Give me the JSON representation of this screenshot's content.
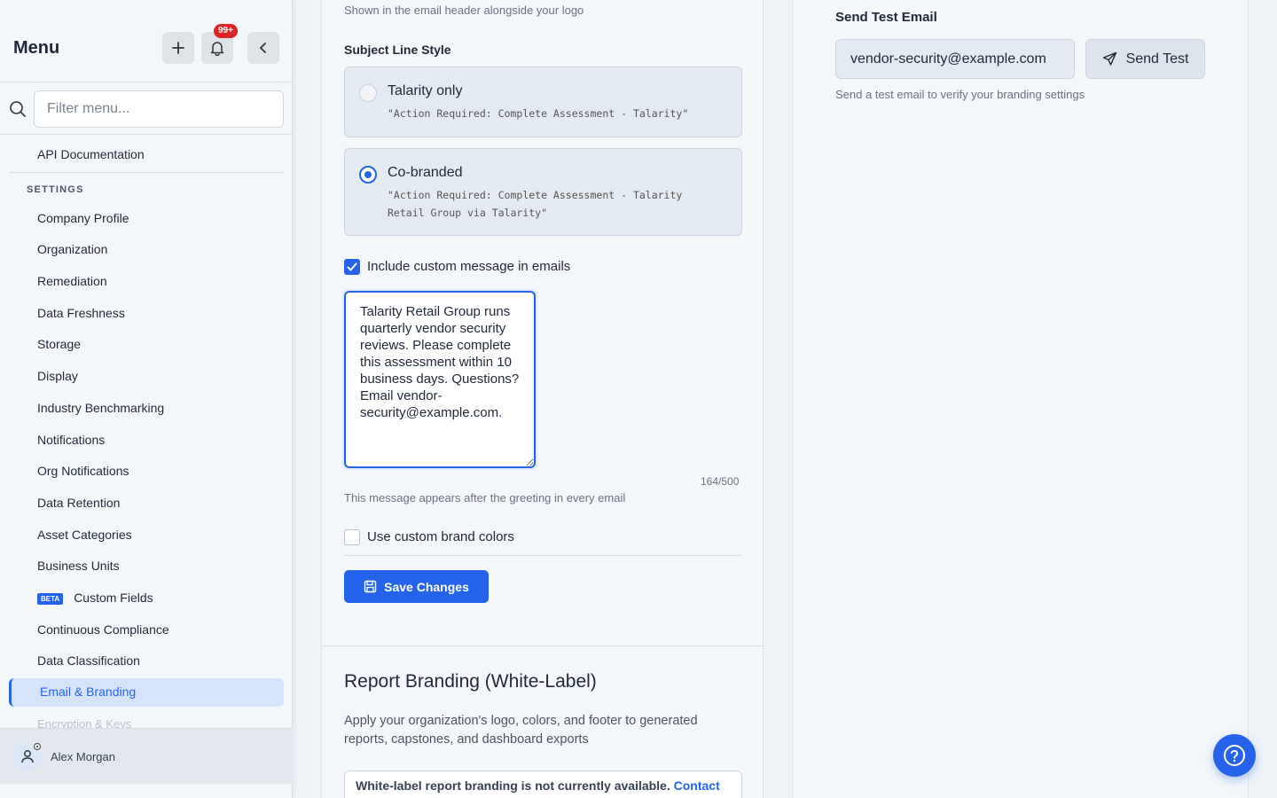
{
  "sidebar": {
    "title": "Menu",
    "notifications_badge": "99+",
    "search_placeholder": "Filter menu...",
    "top_item": "API Documentation",
    "section_label": "SETTINGS",
    "items": [
      "Company Profile",
      "Organization",
      "Remediation",
      "Data Freshness",
      "Storage",
      "Display",
      "Industry Benchmarking",
      "Notifications",
      "Org Notifications",
      "Data Retention",
      "Asset Categories",
      "Business Units",
      "Custom Fields",
      "Continuous Compliance",
      "Data Classification"
    ],
    "beta_label": "BETA",
    "active_item": "Email & Branding",
    "faded_item": "Encryption & Keys",
    "user_name": "Alex Morgan"
  },
  "email_settings": {
    "header_hint": "Shown in the email header alongside your logo",
    "subject_label": "Subject Line Style",
    "options": [
      {
        "title": "Talarity only",
        "desc": "\"Action Required: Complete Assessment - Talarity\"",
        "selected": false
      },
      {
        "title": "Co-branded",
        "desc": "\"Action Required: Complete Assessment - Talarity Retail Group via Talarity\"",
        "selected": true
      }
    ],
    "custom_message_label": "Include custom message in emails",
    "custom_message": "Talarity Retail Group runs quarterly vendor security reviews. Please complete this assessment within 10 business days. Questions? Email vendor-security@example.com.",
    "counter": "164/500",
    "message_hint": "This message appears after the greeting in every email",
    "brand_colors_label": "Use custom brand colors",
    "save_label": "Save Changes"
  },
  "report_branding": {
    "title": "Report Branding (White-Label)",
    "description": "Apply your organization's logo, colors, and footer to generated reports, capstones, and dashboard exports",
    "notice_text": "White-label report branding is not currently available.",
    "notice_link": "Contact"
  },
  "test_email": {
    "title": "Send Test Email",
    "email_value": "vendor-security@example.com",
    "button_label": "Send Test",
    "hint": "Send a test email to verify your branding settings"
  },
  "colors": {
    "accent": "#2563eb",
    "badge": "#dc2626"
  }
}
